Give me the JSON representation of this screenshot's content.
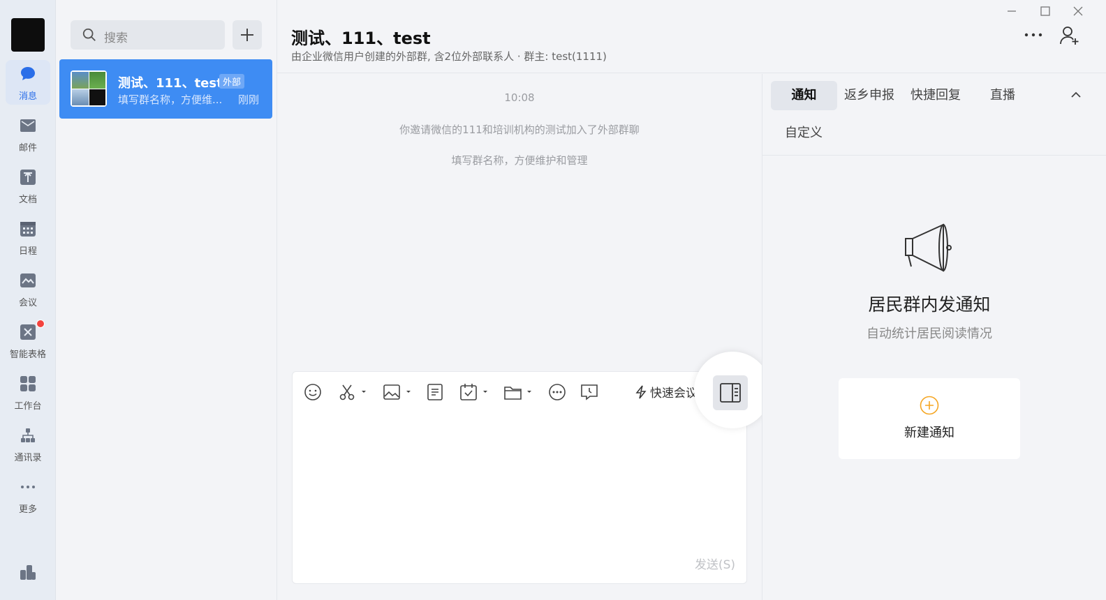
{
  "window": {
    "minimize": "minimize-icon",
    "maximize": "maximize-icon",
    "close": "close-icon"
  },
  "nav": {
    "items": [
      {
        "label": "消息",
        "icon": "chat-icon"
      },
      {
        "label": "邮件",
        "icon": "mail-icon"
      },
      {
        "label": "文档",
        "icon": "doc-icon"
      },
      {
        "label": "日程",
        "icon": "calendar-icon"
      },
      {
        "label": "会议",
        "icon": "meeting-icon"
      },
      {
        "label": "智能表格",
        "icon": "smart-table-icon"
      },
      {
        "label": "工作台",
        "icon": "workbench-icon"
      },
      {
        "label": "通讯录",
        "icon": "contacts-icon"
      },
      {
        "label": "更多",
        "icon": "more-icon"
      }
    ]
  },
  "search": {
    "placeholder": "搜索"
  },
  "conversation": {
    "title": "测试、111、test",
    "tag": "外部",
    "preview": "填写群名称，方便维...",
    "time": "刚刚"
  },
  "chat": {
    "title": "测试、111、test",
    "subtitle": "由企业微信用户创建的外部群, 含2位外部联系人 · 群主: test(1111)",
    "messages": [
      {
        "text": "10:08"
      },
      {
        "text": "你邀请微信的111和培训机构的测试加入了外部群聊"
      },
      {
        "text": "填写群名称，方便维护和管理"
      }
    ]
  },
  "composer": {
    "quick_meeting": "快速会议",
    "send": "发送(S)"
  },
  "panel": {
    "tabs": [
      "通知",
      "返乡申报",
      "快捷回复",
      "直播",
      "自定义"
    ],
    "notice_title": "居民群内发通知",
    "notice_sub": "自动统计居民阅读情况",
    "new_notice": "新建通知"
  },
  "colors": {
    "accent": "#3e8cf3",
    "badge": "#f3433e",
    "plus": "#f5a623"
  }
}
